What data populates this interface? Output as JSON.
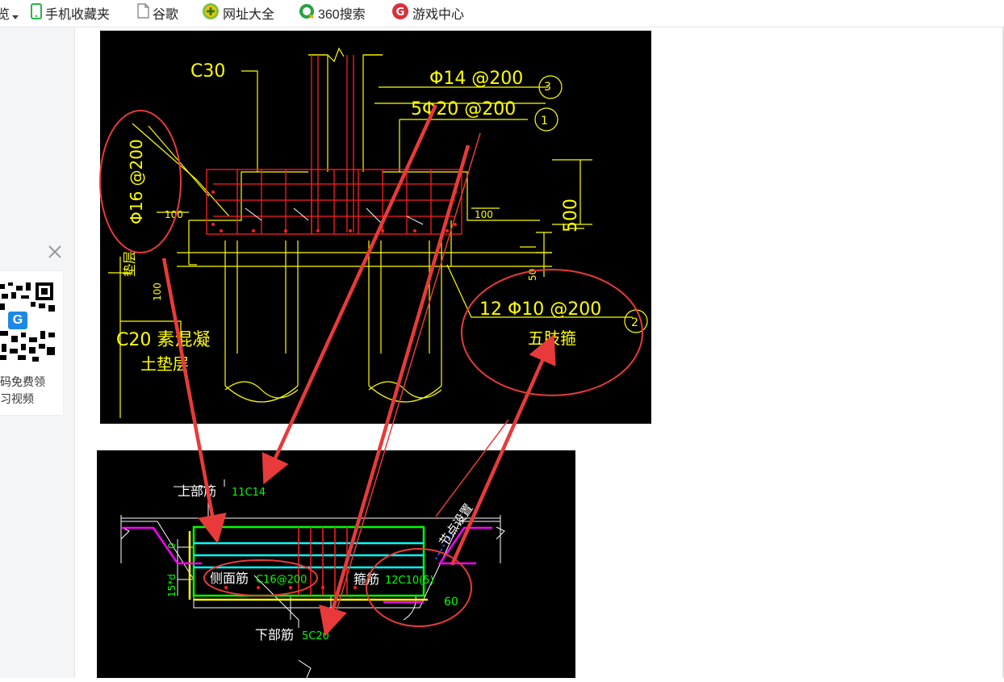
{
  "bookmarks_bar": {
    "partial_label": "览",
    "items": [
      {
        "icon": "phone-icon",
        "label": "手机收藏夹"
      },
      {
        "icon": "page-icon",
        "label": "谷歌"
      },
      {
        "icon": "plus-circle-icon",
        "label": "网址大全"
      },
      {
        "icon": "search-360-icon",
        "label": "360搜索"
      },
      {
        "icon": "game-center-icon",
        "label": "游戏中心"
      }
    ]
  },
  "ad_panel": {
    "line1": "码免费领",
    "line2": "习视频",
    "qr_badge": "G"
  },
  "drawing_top": {
    "concrete": "C30",
    "rebar_top": "Φ14 @200",
    "rebar_bottom": "5Φ20 @200",
    "rebar_side": "Φ16 @200",
    "stirrup": "12 Φ10 @200",
    "stirrup_note": "五肢箍",
    "dim_500": "500",
    "dim_100_left": "100",
    "dim_100_right": "100",
    "dim_50": "50",
    "dim_100_bottom": "100",
    "cushion": "C20 素混凝",
    "cushion2": "土垫层",
    "side_label": "垫层",
    "marker_1": "1",
    "marker_2": "2",
    "marker_3": "3"
  },
  "drawing_bottom": {
    "top_rebar_label": "上部筋",
    "top_rebar_value": "11C14",
    "side_rebar_label": "侧面筋",
    "side_rebar_value": "C16@200",
    "stirrup_label": "箍筋",
    "stirrup_value": "12C10(5)",
    "bottom_rebar_label": "下部筋",
    "bottom_rebar_value": "5C20",
    "node_note": "节点设置",
    "angle": "60",
    "dim_zero": "0",
    "dim_left": "15*d"
  },
  "colors": {
    "annotation_red": "#e83a3a",
    "cad_yellow": "#ffff00",
    "cad_green": "#00ff00",
    "cad_cyan": "#00ffff",
    "cad_magenta": "#ff00ff"
  }
}
